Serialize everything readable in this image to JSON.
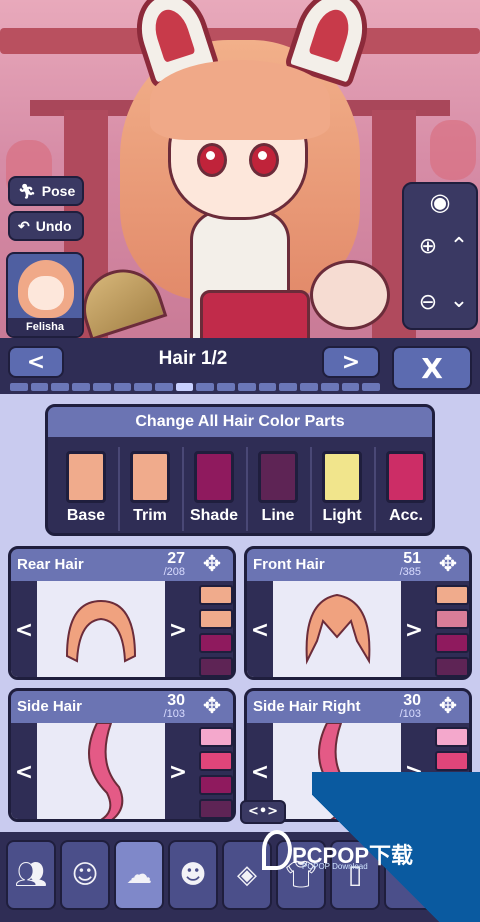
{
  "scene": {
    "pose_label": "Pose",
    "undo_label": "Undo",
    "avatar_name": "Felisha"
  },
  "panel": {
    "title": "Hair 1/2",
    "prev_label": "<",
    "next_label": ">",
    "close_label": "X",
    "page_count": 18,
    "active_page": 8
  },
  "color_parts": {
    "title": "Change All Hair Color Parts",
    "swatches": [
      {
        "label": "Base",
        "color": "#f0ab8c"
      },
      {
        "label": "Trim",
        "color": "#f0ab8c"
      },
      {
        "label": "Shade",
        "color": "#8f1a5e"
      },
      {
        "label": "Line",
        "color": "#5e2455"
      },
      {
        "label": "Light",
        "color": "#f1e58c"
      },
      {
        "label": "Acc.",
        "color": "#cc2d66"
      }
    ]
  },
  "parts": [
    {
      "name": "Rear Hair",
      "number": "27",
      "total": "/208",
      "colors": [
        "#f0ab8c",
        "#f0ab8c",
        "#8f1a5e",
        "#5e2455"
      ]
    },
    {
      "name": "Front Hair",
      "number": "51",
      "total": "/385",
      "colors": [
        "#f0ab8c",
        "#d97d98",
        "#8f1a5e",
        "#5e2455"
      ]
    },
    {
      "name": "Side Hair",
      "number": "30",
      "total": "/103",
      "colors": [
        "#f4a8cc",
        "#e0457a",
        "#8f1a5e",
        "#5e2455"
      ]
    },
    {
      "name": "Side Hair Right",
      "number": "30",
      "total": "/103",
      "colors": [
        "#f4a8cc",
        "#e0457a",
        "#8f1a5e",
        "#5e2455"
      ]
    }
  ],
  "expand_label": "<•>",
  "watermark": {
    "text": "PCPOP下载",
    "sub": "PCPOP Download"
  },
  "icons": [
    "pose-icon",
    "undo-icon",
    "eye-icon",
    "zoom-in-icon",
    "zoom-out-icon",
    "arrow-up-icon",
    "arrow-down-icon",
    "move-icon"
  ]
}
